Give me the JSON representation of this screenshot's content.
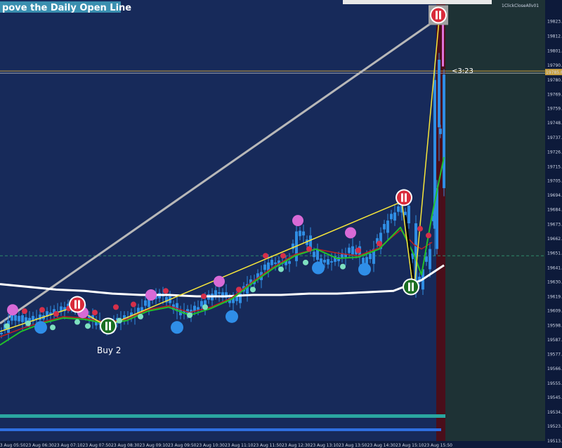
{
  "header": {
    "title": "pove the Daily Open Line",
    "top_right_label": "1ClickCloseAllv01"
  },
  "colors": {
    "background": "#172a5a",
    "right_zone": "#1e3235",
    "highlight_bar": "#4a0e1a",
    "candle_up": "#2f8de3",
    "candle_down": "#2f8de3",
    "white_ma": "#ffffff",
    "green_ma": "#22c02a",
    "red_ma": "#c02020",
    "zigzag_yellow": "#f7e63a",
    "grey_line": "#b8b8b8",
    "sell_signal": "#d92a3a",
    "buy_signal": "#1b6e22",
    "top_dot": "#d86ad6",
    "bottom_dot": "#2f8ee8"
  },
  "annotations": {
    "buy_label": "Buy 2",
    "countdown": "<3:23",
    "current_price_label": "19785.61"
  },
  "chart_data": {
    "type": "line",
    "title": "pove the Daily Open Line",
    "ylim": [
      19513.0,
      19835.0
    ],
    "y_ticks": [
      "19823.20",
      "19812.40",
      "19801.60",
      "19790.80",
      "19780.00",
      "19769.20",
      "19759.00",
      "19748.20",
      "19737.40",
      "19726.60",
      "19715.80",
      "19705.30",
      "19694.80",
      "19684.00",
      "19673.20",
      "19662.70",
      "19651.90",
      "19641.10",
      "19630.60",
      "19619.80",
      "19609.30",
      "19598.50",
      "19587.70",
      "19577.20",
      "19566.40",
      "19555.60",
      "19545.10",
      "19534.30",
      "19523.80",
      "19513.00"
    ],
    "x_ticks": [
      "23 Aug 05:50",
      "23 Aug 06:30",
      "23 Aug 07:10",
      "23 Aug 07:50",
      "23 Aug 08:30",
      "23 Aug 09:10",
      "23 Aug 09:50",
      "23 Aug 10:30",
      "23 Aug 11:10",
      "23 Aug 11:50",
      "23 Aug 12:30",
      "23 Aug 13:10",
      "23 Aug 13:50",
      "23 Aug 14:30",
      "23 Aug 15:10",
      "23 Aug 15:50"
    ],
    "current_price": 19785.61,
    "daily_open_line": 19650.0,
    "price_path": [
      [
        0,
        19593
      ],
      [
        10,
        19602
      ],
      [
        20,
        19606
      ],
      [
        30,
        19601
      ],
      [
        40,
        19604
      ],
      [
        50,
        19603
      ],
      [
        60,
        19606
      ],
      [
        70,
        19608
      ],
      [
        80,
        19609
      ],
      [
        90,
        19612
      ],
      [
        100,
        19613
      ],
      [
        110,
        19610
      ],
      [
        120,
        19606
      ],
      [
        130,
        19602
      ],
      [
        140,
        19599
      ],
      [
        150,
        19597
      ],
      [
        160,
        19601
      ],
      [
        170,
        19603
      ],
      [
        180,
        19605
      ],
      [
        190,
        19607
      ],
      [
        200,
        19612
      ],
      [
        210,
        19618
      ],
      [
        220,
        19621
      ],
      [
        230,
        19620
      ],
      [
        240,
        19615
      ],
      [
        250,
        19609
      ],
      [
        260,
        19607
      ],
      [
        270,
        19610
      ],
      [
        280,
        19612
      ],
      [
        290,
        19617
      ],
      [
        300,
        19622
      ],
      [
        310,
        19623
      ],
      [
        320,
        19619
      ],
      [
        330,
        19615
      ],
      [
        340,
        19622
      ],
      [
        350,
        19629
      ],
      [
        360,
        19632
      ],
      [
        370,
        19638
      ],
      [
        380,
        19645
      ],
      [
        390,
        19645
      ],
      [
        400,
        19644
      ],
      [
        410,
        19646
      ],
      [
        420,
        19668
      ],
      [
        430,
        19665
      ],
      [
        440,
        19655
      ],
      [
        450,
        19647
      ],
      [
        460,
        19645
      ],
      [
        470,
        19646
      ],
      [
        480,
        19649
      ],
      [
        490,
        19651
      ],
      [
        500,
        19657
      ],
      [
        510,
        19649
      ],
      [
        520,
        19644
      ],
      [
        530,
        19655
      ],
      [
        540,
        19667
      ],
      [
        550,
        19676
      ],
      [
        560,
        19682
      ],
      [
        570,
        19687
      ],
      [
        580,
        19674
      ],
      [
        590,
        19625
      ],
      [
        600,
        19640
      ],
      [
        610,
        19655
      ],
      [
        620,
        19700
      ],
      [
        630,
        19784
      ]
    ],
    "white_ma": [
      [
        0,
        19629
      ],
      [
        40,
        19627
      ],
      [
        80,
        19625
      ],
      [
        120,
        19624
      ],
      [
        160,
        19622
      ],
      [
        200,
        19621
      ],
      [
        240,
        19621
      ],
      [
        280,
        19620
      ],
      [
        320,
        19620
      ],
      [
        360,
        19621
      ],
      [
        400,
        19621
      ],
      [
        440,
        19622
      ],
      [
        480,
        19622
      ],
      [
        520,
        19623
      ],
      [
        560,
        19624
      ],
      [
        600,
        19632
      ],
      [
        632,
        19643
      ]
    ],
    "green_ma": [
      [
        0,
        19584
      ],
      [
        30,
        19594
      ],
      [
        60,
        19600
      ],
      [
        90,
        19604
      ],
      [
        120,
        19603
      ],
      [
        150,
        19600
      ],
      [
        180,
        19602
      ],
      [
        210,
        19609
      ],
      [
        240,
        19612
      ],
      [
        270,
        19606
      ],
      [
        300,
        19611
      ],
      [
        330,
        19618
      ],
      [
        360,
        19630
      ],
      [
        390,
        19641
      ],
      [
        420,
        19650
      ],
      [
        450,
        19655
      ],
      [
        480,
        19648
      ],
      [
        510,
        19649
      ],
      [
        540,
        19655
      ],
      [
        570,
        19671
      ],
      [
        590,
        19650
      ],
      [
        600,
        19636
      ],
      [
        615,
        19680
      ],
      [
        632,
        19723
      ]
    ],
    "red_ma": [
      [
        0,
        19590
      ],
      [
        30,
        19596
      ],
      [
        60,
        19601
      ],
      [
        90,
        19605
      ],
      [
        120,
        19604
      ],
      [
        150,
        19601
      ],
      [
        180,
        19603
      ],
      [
        210,
        19610
      ],
      [
        240,
        19613
      ],
      [
        270,
        19608
      ],
      [
        300,
        19612
      ],
      [
        330,
        19619
      ],
      [
        360,
        19631
      ],
      [
        390,
        19642
      ],
      [
        420,
        19651
      ],
      [
        450,
        19655
      ],
      [
        480,
        19652
      ],
      [
        510,
        19650
      ],
      [
        540,
        19656
      ],
      [
        570,
        19669
      ],
      [
        590,
        19658
      ],
      [
        600,
        19655
      ],
      [
        615,
        19660
      ]
    ],
    "zigzag_yellow": [
      [
        0,
        19594
      ],
      [
        105,
        19612
      ],
      [
        152,
        19598
      ],
      [
        572,
        19690
      ],
      [
        589,
        19622
      ],
      [
        626,
        19830
      ]
    ],
    "zigzag_black": [
      [
        577,
        19680
      ],
      [
        589,
        19630
      ],
      [
        591,
        19625
      ]
    ],
    "grey_trend": [
      [
        0,
        19600
      ],
      [
        622,
        19825
      ]
    ],
    "sell_signals": [
      [
        110,
        19614
      ],
      [
        575,
        19693
      ],
      [
        624,
        19828
      ]
    ],
    "buy_signals": [
      [
        154,
        19598
      ],
      [
        585,
        19627
      ]
    ],
    "top_dots": [
      [
        18,
        19610
      ],
      [
        118,
        19608
      ],
      [
        215,
        19621
      ],
      [
        312,
        19631
      ],
      [
        424,
        19676
      ],
      [
        499,
        19667
      ]
    ],
    "bottom_dots": [
      [
        58,
        19597
      ],
      [
        252,
        19597
      ],
      [
        330,
        19605
      ],
      [
        453,
        19641
      ],
      [
        519,
        19640
      ]
    ]
  }
}
